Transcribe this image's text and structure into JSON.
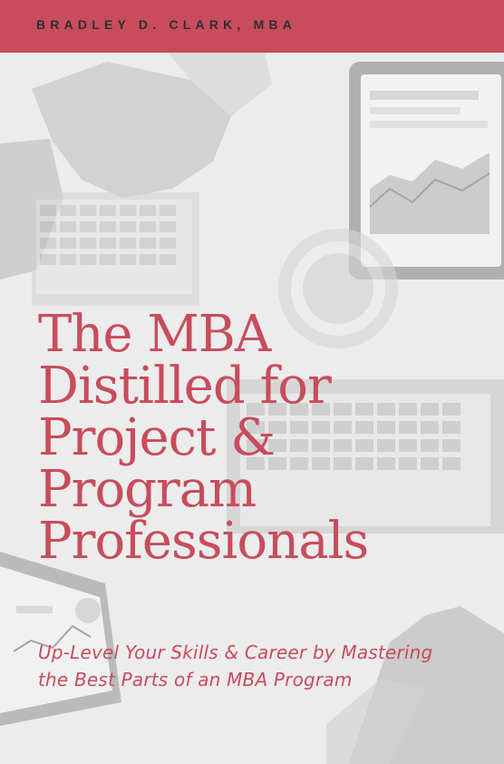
{
  "cover": {
    "author": "BRADLEY D. CLARK, MBA",
    "title_lines": [
      "The MBA",
      "Distilled for",
      "Project &",
      "Program",
      "Professionals"
    ],
    "subtitle_lines": [
      "Up-Level Your Skills & Career by Mastering",
      "the Best Parts of an MBA Program"
    ]
  },
  "colors": {
    "accent": "#c84c5c",
    "author_text": "#2f2f2f"
  }
}
